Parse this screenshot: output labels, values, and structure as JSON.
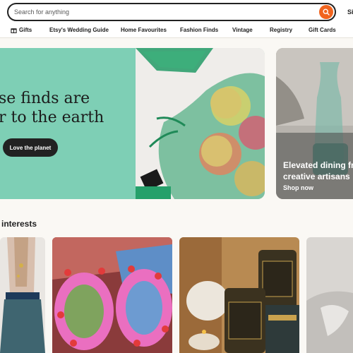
{
  "search": {
    "placeholder": "Search for anything",
    "button_icon": "search-icon",
    "accent": "#f1641e"
  },
  "header": {
    "user_link": "Si"
  },
  "categories": [
    {
      "label": "Gifts",
      "icon": "gift-icon"
    },
    {
      "label": "Etsy's Wedding Guide"
    },
    {
      "label": "Home Favourites"
    },
    {
      "label": "Fashion Finds"
    },
    {
      "label": "Vintage"
    },
    {
      "label": "Registry"
    },
    {
      "label": "Gift Cards"
    }
  ],
  "hero": {
    "headline_line1": "se finds are",
    "headline_line2": "r to the earth",
    "button_label": "Love the planet",
    "background": "#7ecfb5"
  },
  "side_card": {
    "title_line1": "Elevated dining fro",
    "title_line2": "creative artisans",
    "link_label": "Shop now"
  },
  "interests": {
    "title": "interests"
  }
}
